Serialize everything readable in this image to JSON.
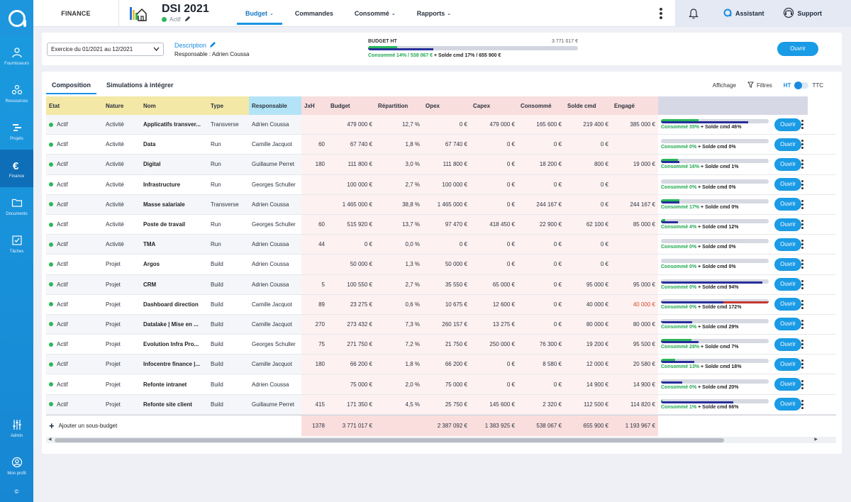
{
  "sidebar": {
    "items": [
      {
        "key": "fournisseurs",
        "label": "Fournisseurs",
        "icon": "users-icon",
        "active": false
      },
      {
        "key": "ressources",
        "label": "Ressources",
        "icon": "resources-icon",
        "active": false
      },
      {
        "key": "projets",
        "label": "Projets",
        "icon": "projects-icon",
        "active": false
      },
      {
        "key": "finance",
        "label": "Finance",
        "icon": "euro-icon",
        "active": true
      },
      {
        "key": "documents",
        "label": "Documents",
        "icon": "folder-icon",
        "active": false
      },
      {
        "key": "taches",
        "label": "Tâches",
        "icon": "checklist-icon",
        "active": false
      }
    ],
    "bottom": [
      {
        "key": "admin",
        "label": "Admin",
        "icon": "sliders-icon"
      },
      {
        "key": "profil",
        "label": "Mon profil",
        "icon": "profile-icon"
      }
    ],
    "copyright": "©"
  },
  "header": {
    "module": "FINANCE",
    "title": "DSI 2021",
    "status": "Actif",
    "tabs": [
      {
        "label": "Budget",
        "dropdown": true,
        "active": true
      },
      {
        "label": "Commandes",
        "dropdown": false,
        "active": false
      },
      {
        "label": "Consommé",
        "dropdown": true,
        "active": false
      },
      {
        "label": "Rapports",
        "dropdown": true,
        "active": false
      }
    ],
    "assistant": "Assistant",
    "support": "Support"
  },
  "summary": {
    "exercise": "Exercice du 01/2021 au 12/2021",
    "description_label": "Description",
    "responsable": "Responsable : Adrien Coussa",
    "budget_label": "BUDGET HT",
    "budget_value": "3 771 017 €",
    "consumed_pct": 14,
    "solde_pct": 17,
    "consumed_text": "Consommé 14% / 538 067 €",
    "solde_text": "+ Solde cmd 17% / 655 900 €",
    "open_label": "Ouvrir"
  },
  "subtabs": [
    "Composition",
    "Simulations à intégrer"
  ],
  "display": {
    "affichage": "Affichage",
    "filtres": "Filtres",
    "ht": "HT",
    "ttc": "TTC"
  },
  "table": {
    "columns": [
      "Etat",
      "Nature",
      "Nom",
      "Type",
      "Responsable",
      "JxH",
      "Budget",
      "Répartition",
      "Opex",
      "Capex",
      "Consommé",
      "Solde cmd",
      "Engagé"
    ],
    "open_label": "Ouvrir",
    "rows": [
      {
        "etat": "Actif",
        "nature": "Activité",
        "nom": "Applicatifs transver...",
        "type": "Transverse",
        "resp": "Adrien Coussa",
        "jxh": "",
        "budget": "479 000 €",
        "rep": "12,7 %",
        "opex": "0 €",
        "capex": "479 000 €",
        "cons": "165 600 €",
        "solde": "219 400 €",
        "eng": "385 000 €",
        "eng_red": false,
        "c_pct": 35,
        "s_pct": 46,
        "prog": "Consommé 35%",
        "prog2": "+ Solde cmd 46%"
      },
      {
        "etat": "Actif",
        "nature": "Activité",
        "nom": "Data",
        "type": "Run",
        "resp": "Camille Jacquot",
        "jxh": "60",
        "budget": "67 740 €",
        "rep": "1,8 %",
        "opex": "67 740 €",
        "capex": "0 €",
        "cons": "0 €",
        "solde": "0 €",
        "eng": "",
        "eng_red": false,
        "c_pct": 0,
        "s_pct": 0,
        "prog": "Consommé 0%",
        "prog2": "+ Solde cmd 0%"
      },
      {
        "etat": "Actif",
        "nature": "Activité",
        "nom": "Digital",
        "type": "Run",
        "resp": "Guillaume Perret",
        "jxh": "180",
        "budget": "111 800 €",
        "rep": "3,0 %",
        "opex": "111 800 €",
        "capex": "0 €",
        "cons": "18 200 €",
        "solde": "800 €",
        "eng": "19 000 €",
        "eng_red": false,
        "c_pct": 16,
        "s_pct": 1,
        "prog": "Consommé 16%",
        "prog2": "+ Solde cmd 1%"
      },
      {
        "etat": "Actif",
        "nature": "Activité",
        "nom": "Infrastructure",
        "type": "Run",
        "resp": "Georges Schuller",
        "jxh": "",
        "budget": "100 000 €",
        "rep": "2,7 %",
        "opex": "100 000 €",
        "capex": "0 €",
        "cons": "0 €",
        "solde": "0 €",
        "eng": "",
        "eng_red": false,
        "c_pct": 0,
        "s_pct": 0,
        "prog": "Consommé 0%",
        "prog2": "+ Solde cmd 0%"
      },
      {
        "etat": "Actif",
        "nature": "Activité",
        "nom": "Masse salariale",
        "type": "Transverse",
        "resp": "Adrien Coussa",
        "jxh": "",
        "budget": "1 465 000 €",
        "rep": "38,8 %",
        "opex": "1 465 000 €",
        "capex": "0 €",
        "cons": "244 167 €",
        "solde": "0 €",
        "eng": "244 167 €",
        "eng_red": false,
        "c_pct": 17,
        "s_pct": 0,
        "prog": "Consommé 17%",
        "prog2": "+ Solde cmd 0%"
      },
      {
        "etat": "Actif",
        "nature": "Activité",
        "nom": "Poste de travail",
        "type": "Run",
        "resp": "Georges Schuller",
        "jxh": "60",
        "budget": "515 920 €",
        "rep": "13,7 %",
        "opex": "97 470 €",
        "capex": "418 450 €",
        "cons": "22 900 €",
        "solde": "62 100 €",
        "eng": "85 000 €",
        "eng_red": false,
        "c_pct": 4,
        "s_pct": 12,
        "prog": "Consommé 4%",
        "prog2": "+ Solde cmd 12%"
      },
      {
        "etat": "Actif",
        "nature": "Activité",
        "nom": "TMA",
        "type": "Run",
        "resp": "Adrien Coussa",
        "jxh": "44",
        "budget": "0 €",
        "rep": "0,0 %",
        "opex": "0 €",
        "capex": "0 €",
        "cons": "0 €",
        "solde": "0 €",
        "eng": "",
        "eng_red": false,
        "c_pct": 0,
        "s_pct": 0,
        "prog": "Consommé 0%",
        "prog2": "+ Solde cmd 0%"
      },
      {
        "etat": "Actif",
        "nature": "Projet",
        "nom": "Argos",
        "type": "Build",
        "resp": "Adrien Coussa",
        "jxh": "",
        "budget": "50 000 €",
        "rep": "1,3 %",
        "opex": "50 000 €",
        "capex": "0 €",
        "cons": "0 €",
        "solde": "0 €",
        "eng": "",
        "eng_red": false,
        "c_pct": 0,
        "s_pct": 0,
        "prog": "Consommé 0%",
        "prog2": "+ Solde cmd 0%"
      },
      {
        "etat": "Actif",
        "nature": "Projet",
        "nom": "CRM",
        "type": "Build",
        "resp": "Adrien Coussa",
        "jxh": "5",
        "budget": "100 550 €",
        "rep": "2,7 %",
        "opex": "35 550 €",
        "capex": "65 000 €",
        "cons": "0 €",
        "solde": "95 000 €",
        "eng": "95 000 €",
        "eng_red": false,
        "c_pct": 0,
        "s_pct": 94,
        "prog": "Consommé 0%",
        "prog2": "+ Solde cmd 94%"
      },
      {
        "etat": "Actif",
        "nature": "Projet",
        "nom": "Dashboard direction",
        "type": "Build",
        "resp": "Camille Jacquot",
        "jxh": "89",
        "budget": "23 275 €",
        "rep": "0,6 %",
        "opex": "10 675 €",
        "capex": "12 600 €",
        "cons": "0 €",
        "solde": "40 000 €",
        "eng": "40 000 €",
        "eng_red": true,
        "c_pct": 0,
        "s_pct": 172,
        "prog": "Consommé 0%",
        "prog2": "+ Solde cmd 172%"
      },
      {
        "etat": "Actif",
        "nature": "Projet",
        "nom": "Datalake | Mise en ...",
        "type": "Build",
        "resp": "Camille Jacquot",
        "jxh": "270",
        "budget": "273 432 €",
        "rep": "7,3 %",
        "opex": "260 157 €",
        "capex": "13 275 €",
        "cons": "0 €",
        "solde": "80 000 €",
        "eng": "80 000 €",
        "eng_red": false,
        "c_pct": 0,
        "s_pct": 29,
        "prog": "Consommé 0%",
        "prog2": "+ Solde cmd 29%"
      },
      {
        "etat": "Actif",
        "nature": "Projet",
        "nom": "Evolution Infra Pro...",
        "type": "Build",
        "resp": "Georges Schuller",
        "jxh": "75",
        "budget": "271 750 €",
        "rep": "7,2 %",
        "opex": "21 750 €",
        "capex": "250 000 €",
        "cons": "76 300 €",
        "solde": "19 200 €",
        "eng": "95 500 €",
        "eng_red": false,
        "c_pct": 28,
        "s_pct": 7,
        "prog": "Consommé 28%",
        "prog2": "+ Solde cmd 7%"
      },
      {
        "etat": "Actif",
        "nature": "Projet",
        "nom": "Infocentre finance |...",
        "type": "Build",
        "resp": "Camille Jacquot",
        "jxh": "180",
        "budget": "66 200 €",
        "rep": "1,8 %",
        "opex": "66 200 €",
        "capex": "0 €",
        "cons": "8 580 €",
        "solde": "12 000 €",
        "eng": "20 580 €",
        "eng_red": false,
        "c_pct": 13,
        "s_pct": 18,
        "prog": "Consommé 13%",
        "prog2": "+ Solde cmd 18%"
      },
      {
        "etat": "Actif",
        "nature": "Projet",
        "nom": "Refonte intranet",
        "type": "Build",
        "resp": "Adrien Coussa",
        "jxh": "",
        "budget": "75 000 €",
        "rep": "2,0 %",
        "opex": "75 000 €",
        "capex": "0 €",
        "cons": "0 €",
        "solde": "14 900 €",
        "eng": "14 900 €",
        "eng_red": false,
        "c_pct": 0,
        "s_pct": 20,
        "prog": "Consommé 0%",
        "prog2": "+ Solde cmd 20%"
      },
      {
        "etat": "Actif",
        "nature": "Projet",
        "nom": "Refonte site client",
        "type": "Build",
        "resp": "Guillaume Perret",
        "jxh": "415",
        "budget": "171 350 €",
        "rep": "4,5 %",
        "opex": "25 750 €",
        "capex": "145 600 €",
        "cons": "2 320 €",
        "solde": "112 500 €",
        "eng": "114 820 €",
        "eng_red": false,
        "c_pct": 1,
        "s_pct": 66,
        "prog": "Consommé 1%",
        "prog2": "+ Solde cmd 66%"
      }
    ],
    "footer": {
      "add_label": "Ajouter un sous-budget",
      "jxh": "1378",
      "budget": "3 771 017 €",
      "rep": "",
      "opex": "2 387 092 €",
      "capex": "1 383 925 €",
      "cons": "538 067 €",
      "solde": "655 900 €",
      "eng": "1 193 967 €"
    }
  },
  "colors": {
    "accent": "#1a9be6",
    "green": "#2ab85a",
    "navy": "#262f9a",
    "red": "#c6362e"
  }
}
